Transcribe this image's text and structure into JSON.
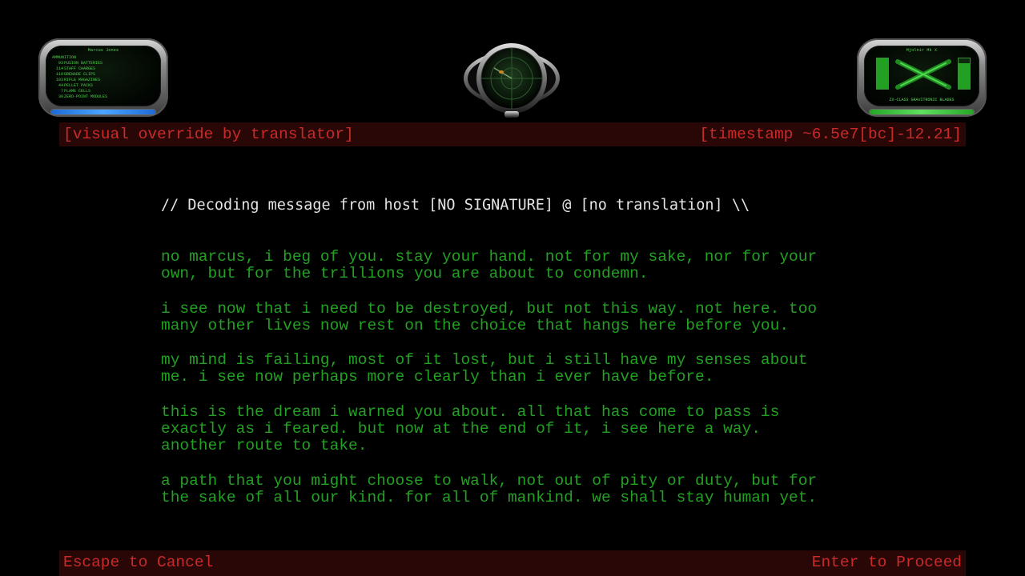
{
  "hud_left": {
    "player_name": "Marcus Jones",
    "section_title": "AMMUNITION",
    "ammo": [
      {
        "qty": "93",
        "name": "FUSION BATTERIES"
      },
      {
        "qty": "114",
        "name": "STAFF CHARGES"
      },
      {
        "qty": "110",
        "name": "GRENADE CLIPS"
      },
      {
        "qty": "103",
        "name": "RIFLE MAGAZINES"
      },
      {
        "qty": "44",
        "name": "PELLET PACKS"
      },
      {
        "qty": "7",
        "name": "FLAME CELLS"
      },
      {
        "qty": "30",
        "name": "ZERO-POINT MODULES"
      }
    ],
    "shield_fraction": 1.0,
    "shield_color": "#3b8fff"
  },
  "hud_right": {
    "armor_name": "Mjolnir Mk X",
    "weapon_name": "ZX-CLASS GRAVITRONIC BLADES",
    "weapon_icon": "crossed-blades-icon",
    "left_charge_fraction": 1.0,
    "right_charge_fraction": 0.85,
    "energy_fraction": 1.0,
    "energy_color": "#3fcf3f"
  },
  "radar": {
    "icon": "motion-tracker-icon"
  },
  "top_bar": {
    "left": "[visual override by translator]",
    "right": "[timestamp ~6.5e7[bc]-12.21]"
  },
  "decode_header": "// Decoding message from host [NO SIGNATURE] @ [no translation] \\\\",
  "message": {
    "paragraphs": [
      "no marcus, i beg of you. stay your hand. not for my sake, nor for your\nown, but for the trillions you are about to condemn.",
      "i see now that i need to be destroyed, but not this way. not here. too\nmany other lives now rest on the choice that hangs here before you.",
      "my mind is failing, most of it lost, but i still have my senses about\nme. i see now perhaps more clearly than i ever have before.",
      "this is the dream i warned you about. all that has come to pass is\nexactly as i feared. but now at the end of it, i see here a way.\nanother route to take.",
      "a path that you might choose to walk, not out of pity or duty, but for\nthe sake of all our kind. for all of mankind. we shall stay human yet."
    ]
  },
  "bottom_bar": {
    "cancel": "Escape to Cancel",
    "proceed": "Enter to Proceed"
  },
  "colors": {
    "background": "#000000",
    "message_text": "#22a022",
    "header_text": "#e4e4e4",
    "bar_background": "#2a0707",
    "bar_text": "#c92a2a"
  }
}
